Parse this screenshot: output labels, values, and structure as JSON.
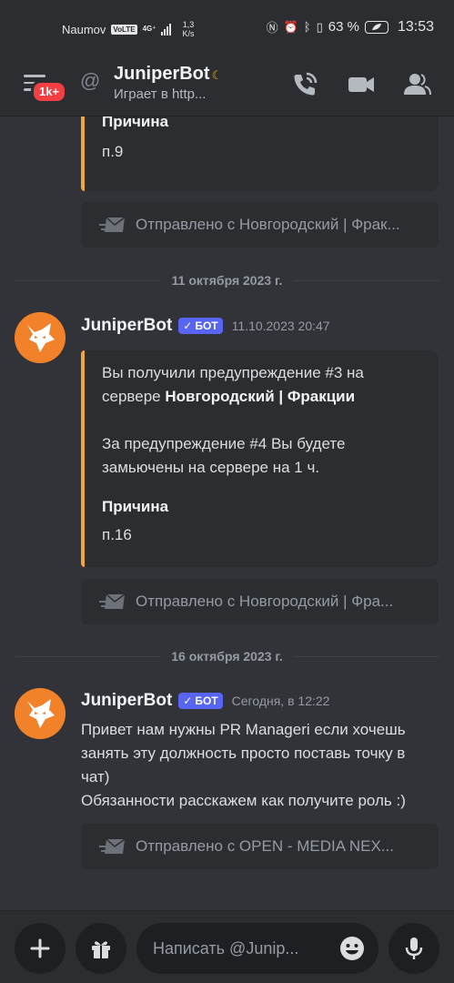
{
  "status_bar": {
    "operator": "Naumov",
    "volte": "VoLTE",
    "network": "4G⁺",
    "speed_value": "1,3",
    "speed_unit": "K/s",
    "battery": "63 %",
    "time": "13:53"
  },
  "header": {
    "unread_badge": "1k+",
    "channel_name": "JuniperBot",
    "channel_status": "Играет в http..."
  },
  "chat": {
    "top_embed": {
      "field_name": "Причина",
      "field_value": "п.9"
    },
    "sent_from_1": "Отправлено с Новгородский | Фрак...",
    "divider_1": "11 октября 2023 г.",
    "message_1": {
      "author": "JuniperBot",
      "bot_tag": "БОТ",
      "timestamp": "11.10.2023 20:47",
      "embed": {
        "line1_prefix": "Вы получили предупреждение #3 на",
        "line2_prefix": "сервере ",
        "line2_server": "Новгородский | Фракции",
        "paragraph2_line1": "За предупреждение #4 Вы будете",
        "paragraph2_line2": "замьючены на сервере на 1 ч.",
        "field_name": "Причина",
        "field_value": "п.16"
      },
      "sent_from": "Отправлено с Новгородский | Фра..."
    },
    "divider_2": "16 октября 2023 г.",
    "message_2": {
      "author": "JuniperBot",
      "bot_tag": "БОТ",
      "timestamp": "Сегодня, в 12:22",
      "line1": "Привет нам нужны PR Manageri если хочешь",
      "line2": "занять эту должность просто поставь точку в",
      "line3": "чат)",
      "line4": "Обязанности расскажем как получите роль :)",
      "sent_from": "Отправлено с OPEN - MEDIA NEX..."
    }
  },
  "composer": {
    "placeholder": "Написать @Junip..."
  },
  "colors": {
    "background": "#313338",
    "embed_accent": "#f0a73a",
    "bot_tag": "#5865f2",
    "badge": "#f23f43",
    "avatar": "#f2822a"
  },
  "icons": [
    "menu-icon",
    "at-icon",
    "call-icon",
    "video-icon",
    "members-icon",
    "mail-icon",
    "plus-icon",
    "gift-icon",
    "emoji-icon",
    "mic-icon",
    "fox-avatar"
  ]
}
